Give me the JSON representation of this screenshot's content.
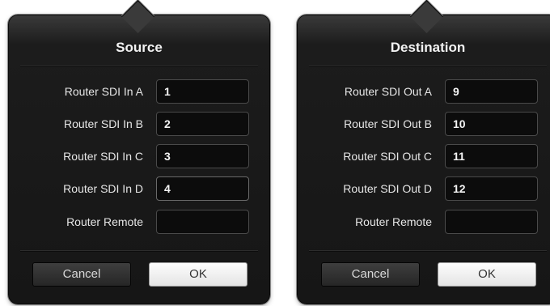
{
  "source": {
    "title": "Source",
    "rows": [
      {
        "label": "Router SDI In A",
        "value": "1"
      },
      {
        "label": "Router SDI In B",
        "value": "2"
      },
      {
        "label": "Router SDI In C",
        "value": "3"
      },
      {
        "label": "Router SDI In D",
        "value": "4"
      },
      {
        "label": "Router Remote",
        "value": ""
      }
    ],
    "cancel_label": "Cancel",
    "ok_label": "OK"
  },
  "destination": {
    "title": "Destination",
    "rows": [
      {
        "label": "Router SDI Out A",
        "value": "9"
      },
      {
        "label": "Router SDI Out B",
        "value": "10"
      },
      {
        "label": "Router SDI Out C",
        "value": "11"
      },
      {
        "label": "Router SDI Out D",
        "value": "12"
      },
      {
        "label": "Router Remote",
        "value": ""
      }
    ],
    "cancel_label": "Cancel",
    "ok_label": "OK"
  }
}
